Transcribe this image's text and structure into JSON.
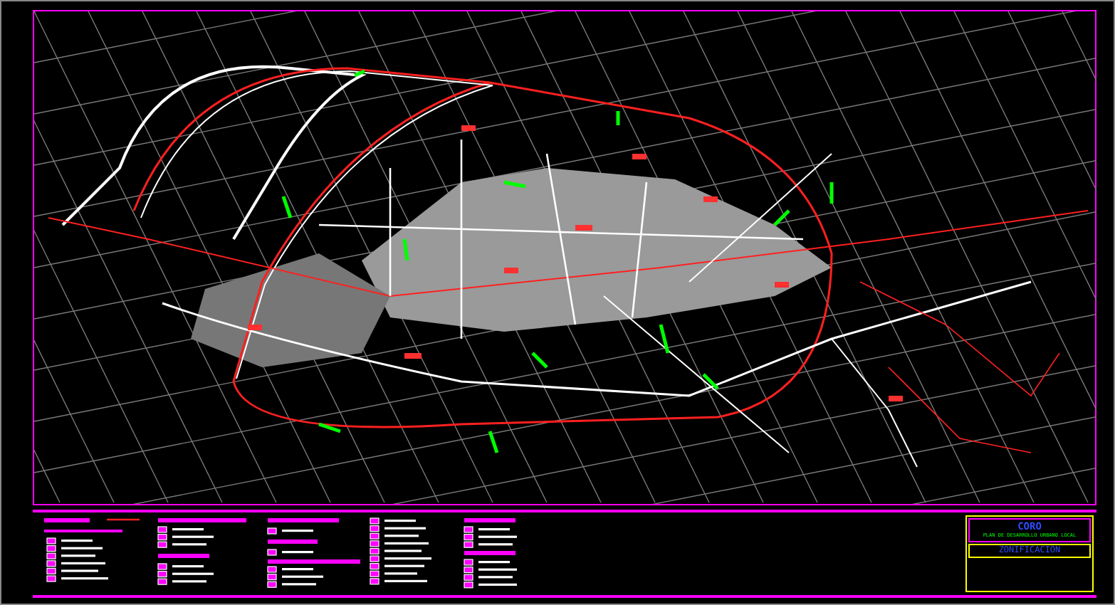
{
  "title_block": {
    "city": "CORO",
    "plan_name": "PLAN DE DESARROLLO URBANO LOCAL",
    "sheet_title": "ZONIFICACION"
  }
}
